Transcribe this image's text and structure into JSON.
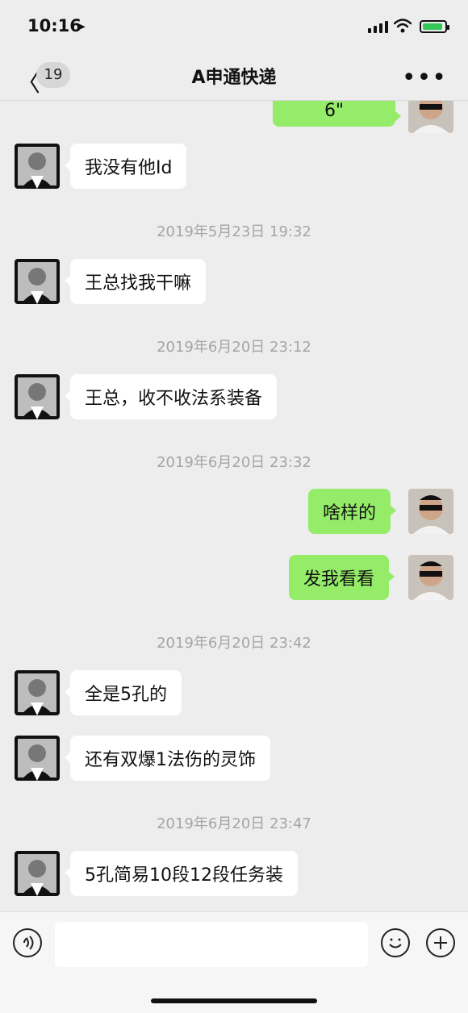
{
  "status": {
    "time": "10:16"
  },
  "header": {
    "back_count": "19",
    "title": "A申通快递",
    "more_label": "•••"
  },
  "messages": {
    "top_partial": "6\"",
    "m1": "我没有他Id",
    "m2": "王总找我干嘛",
    "m3": "王总，收不收法系装备",
    "m4": "啥样的",
    "m5": "发我看看",
    "m6": "全是5孔的",
    "m7": "还有双爆1法伤的灵饰",
    "m8": "5孔简易10段12段任务装"
  },
  "timestamps": {
    "t1": "2019年5月23日 19:32",
    "t2": "2019年6月20日 23:12",
    "t3": "2019年6月20日 23:32",
    "t4": "2019年6月20日 23:42",
    "t5": "2019年6月20日 23:47"
  },
  "icons": {
    "voice": "voice-icon",
    "emoji": "emoji-icon",
    "plus": "plus-icon"
  }
}
